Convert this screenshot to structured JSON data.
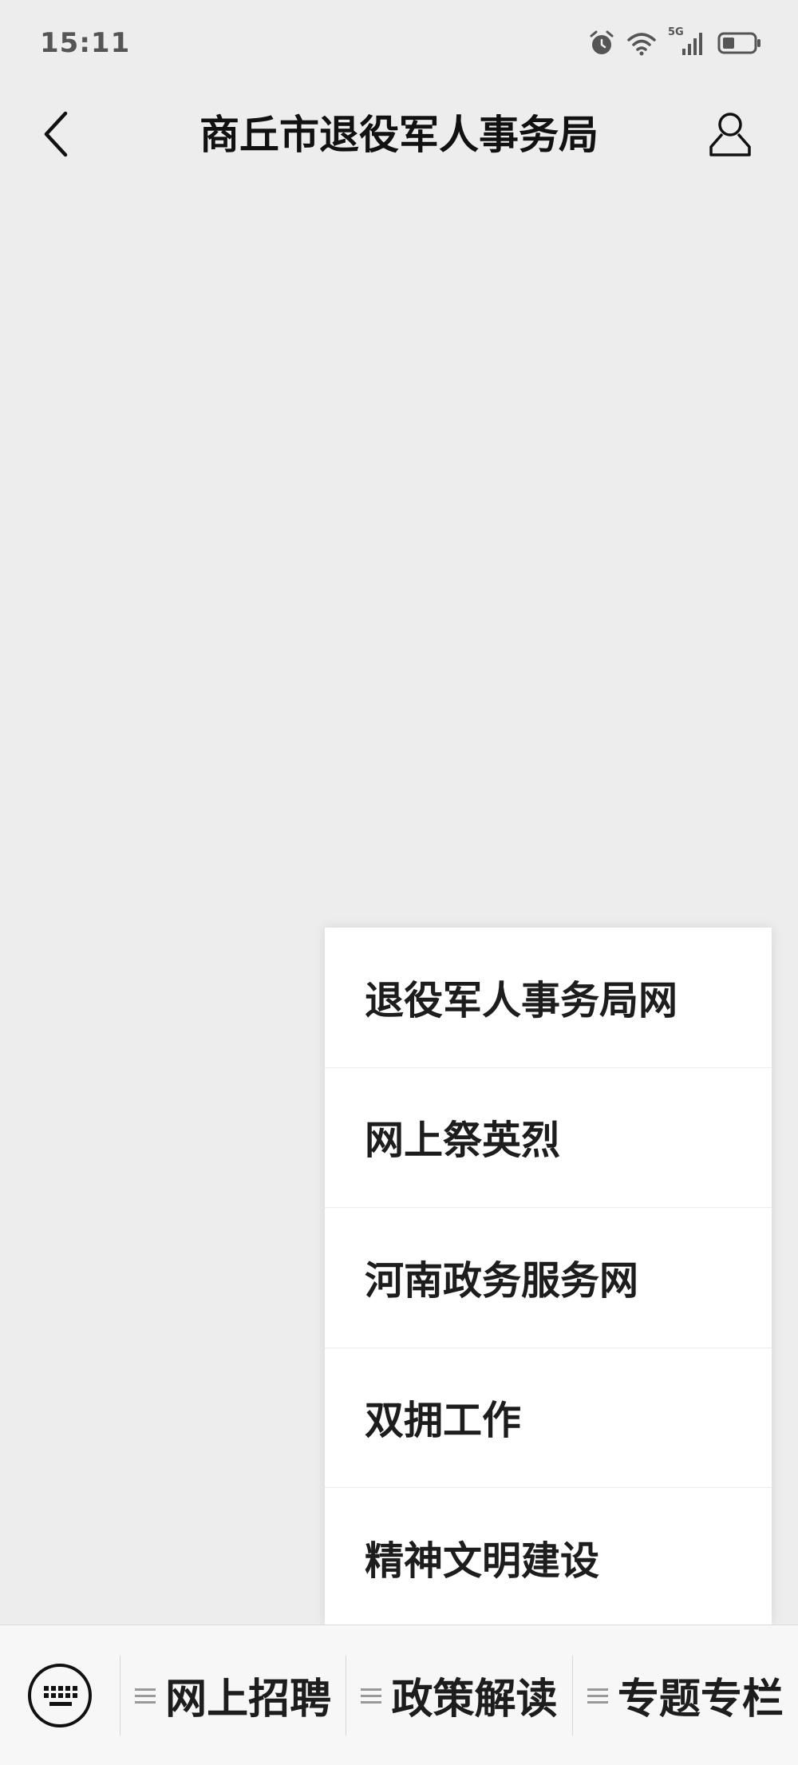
{
  "status_bar": {
    "time": "15:11",
    "network_label": "5G",
    "icons": [
      "alarm-icon",
      "wifi-icon",
      "signal-icon",
      "battery-icon"
    ]
  },
  "header": {
    "title": "商丘市退役军人事务局",
    "back_icon": "chevron-left-icon",
    "profile_icon": "person-icon"
  },
  "popup_menu": {
    "items": [
      {
        "label": "退役军人事务局网"
      },
      {
        "label": "网上祭英烈"
      },
      {
        "label": "河南政务服务网"
      },
      {
        "label": "双拥工作"
      },
      {
        "label": "精神文明建设"
      }
    ]
  },
  "bottom_bar": {
    "keyboard_icon": "keyboard-icon",
    "tabs": [
      {
        "label": "网上招聘"
      },
      {
        "label": "政策解读"
      },
      {
        "label": "专题专栏"
      }
    ]
  },
  "colors": {
    "background": "#ededed",
    "menu_background": "#ffffff",
    "bottom_bar_background": "#f7f7f7",
    "text": "#1a1a1a"
  }
}
